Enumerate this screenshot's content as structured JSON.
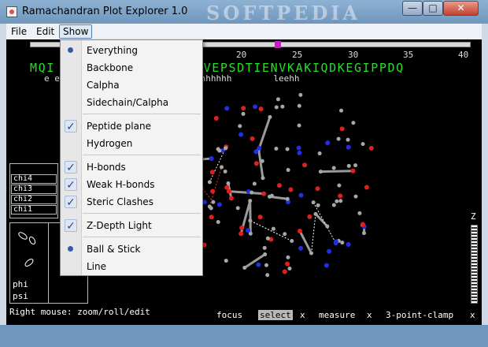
{
  "window": {
    "title": "Ramachandran Plot Explorer 1.0",
    "watermark": "SOFTPEDIA",
    "controls": {
      "minimize": "—",
      "maximize": "□",
      "close": "✕"
    }
  },
  "menubar": {
    "file": "File",
    "edit": "Edit",
    "show": "Show"
  },
  "ruler": {
    "ticks": [
      "20",
      "25",
      "30",
      "35",
      "40"
    ]
  },
  "sequence": {
    "left": "MQI",
    "right": "GVEPSDTIENVKAKIQDKEGIPPDQ",
    "secondary": "e e          e    e    eehhhhhhhhhhh        leehh"
  },
  "chi_panel": {
    "rows": [
      "chi4",
      "chi3",
      "chi2",
      "chi1"
    ]
  },
  "rama_panel": {
    "phi": "phi",
    "psi": "psi"
  },
  "status": {
    "hint": "Right mouse: zoom/roll/edit",
    "modes": {
      "focus": "focus",
      "select": "select",
      "measure": "measure",
      "clamp": "3-point-clamp",
      "x": "x"
    }
  },
  "z_label": "Z",
  "dropdown": {
    "items": [
      {
        "label": "Everything",
        "mark": "radio"
      },
      {
        "label": "Backbone",
        "mark": "none"
      },
      {
        "label": "Calpha",
        "mark": "none"
      },
      {
        "label": "Sidechain/Calpha",
        "mark": "none"
      },
      {
        "label": "Peptide plane",
        "mark": "check"
      },
      {
        "label": "Hydrogen",
        "mark": "none"
      },
      {
        "label": "H-bonds",
        "mark": "check"
      },
      {
        "label": "Weak H-bonds",
        "mark": "check"
      },
      {
        "label": "Steric Clashes",
        "mark": "check"
      },
      {
        "label": "Z-Depth Light",
        "mark": "check"
      },
      {
        "label": "Ball & Stick",
        "mark": "radio"
      },
      {
        "label": "Line",
        "mark": "none"
      }
    ]
  },
  "colors": {
    "sequence": "#22e022",
    "slider_knob": "#c020c0",
    "atom_oxygen": "#e02020",
    "atom_nitrogen": "#2030e0",
    "atom_carbon": "#a8a8a8",
    "hbond": "#ffffff"
  }
}
